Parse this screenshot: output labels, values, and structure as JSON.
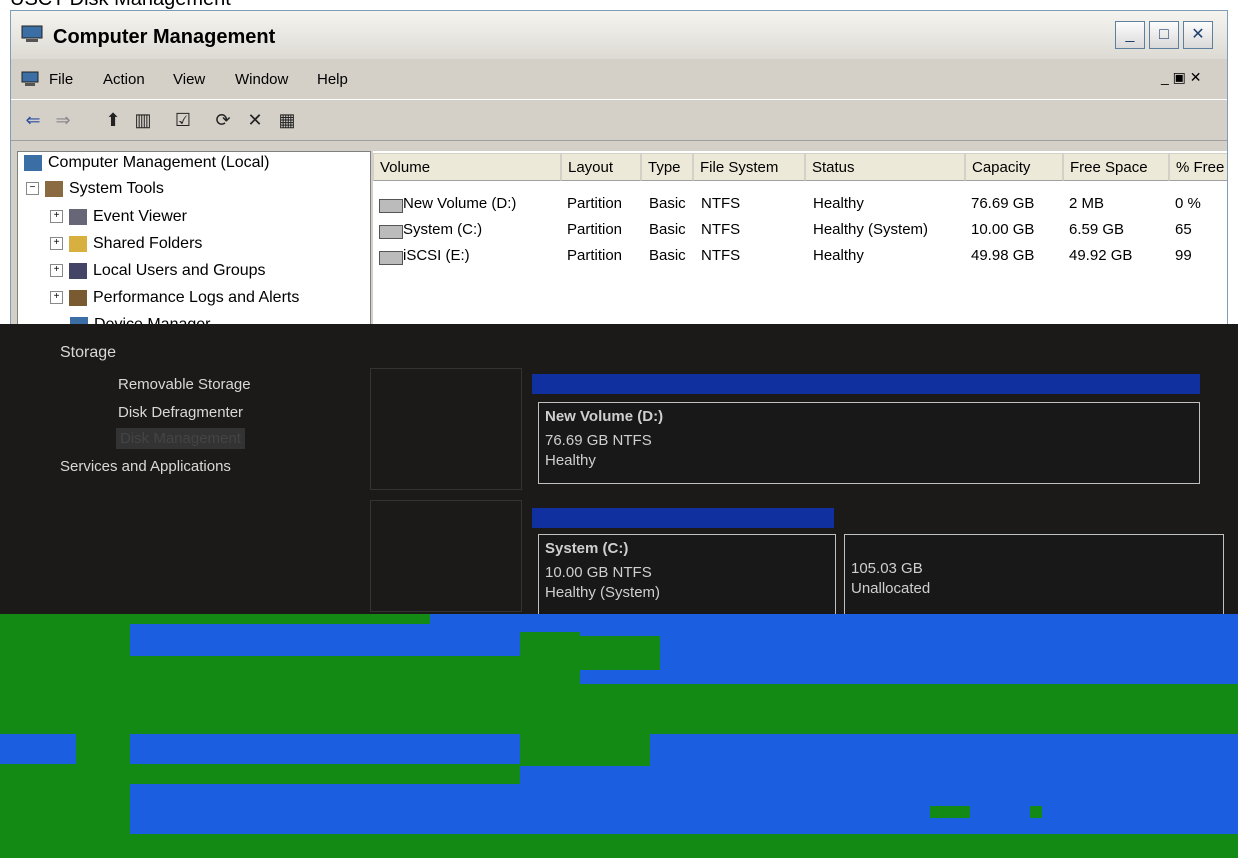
{
  "caption": "USCT Disk Management",
  "window": {
    "title": "Computer Management"
  },
  "menu": [
    {
      "label": "File"
    },
    {
      "label": "Action"
    },
    {
      "label": "View"
    },
    {
      "label": "Window"
    },
    {
      "label": "Help"
    }
  ],
  "tree": [
    {
      "label": "Computer Management (Local)"
    },
    {
      "label": "System Tools"
    },
    {
      "label": "Event Viewer"
    },
    {
      "label": "Shared Folders"
    },
    {
      "label": "Local Users and Groups"
    },
    {
      "label": "Performance Logs and Alerts"
    },
    {
      "label": "Device Manager"
    },
    {
      "label": "Storage"
    },
    {
      "label": "Removable Storage"
    },
    {
      "label": "Disk Defragmenter"
    },
    {
      "label": "Disk Management"
    },
    {
      "label": "Services and Applications"
    }
  ],
  "columns": [
    "Volume",
    "Layout",
    "Type",
    "File System",
    "Status",
    "Capacity",
    "Free Space",
    "% Free"
  ],
  "rows": [
    {
      "volume": "New Volume (D:)",
      "layout": "Partition",
      "type": "Basic",
      "fs": "NTFS",
      "status": "Healthy",
      "capacity": "76.69 GB",
      "free": "2 MB",
      "pct": "0 %"
    },
    {
      "volume": "System (C:)",
      "layout": "Partition",
      "type": "Basic",
      "fs": "NTFS",
      "status": "Healthy (System)",
      "capacity": "10.00 GB",
      "free": "6.59 GB",
      "pct": "65"
    },
    {
      "volume": "iSCSI (E:)",
      "layout": "Partition",
      "type": "Basic",
      "fs": "NTFS",
      "status": "Healthy",
      "capacity": "49.98 GB",
      "free": "49.92 GB",
      "pct": "99"
    }
  ],
  "graphical": {
    "vol1": {
      "name": "New Volume (D:)",
      "size": "76.69 GB NTFS",
      "status": "Healthy"
    },
    "vol2": {
      "name": "System (C:)",
      "size": "10.00 GB NTFS",
      "status": "Healthy (System)"
    },
    "unalloc": {
      "size": "105.03 GB",
      "label": "Unallocated"
    }
  },
  "colors": {
    "volume_header": "#1030a0",
    "glitch_blue": "#1c5ee0",
    "glitch_green": "#138a13"
  }
}
